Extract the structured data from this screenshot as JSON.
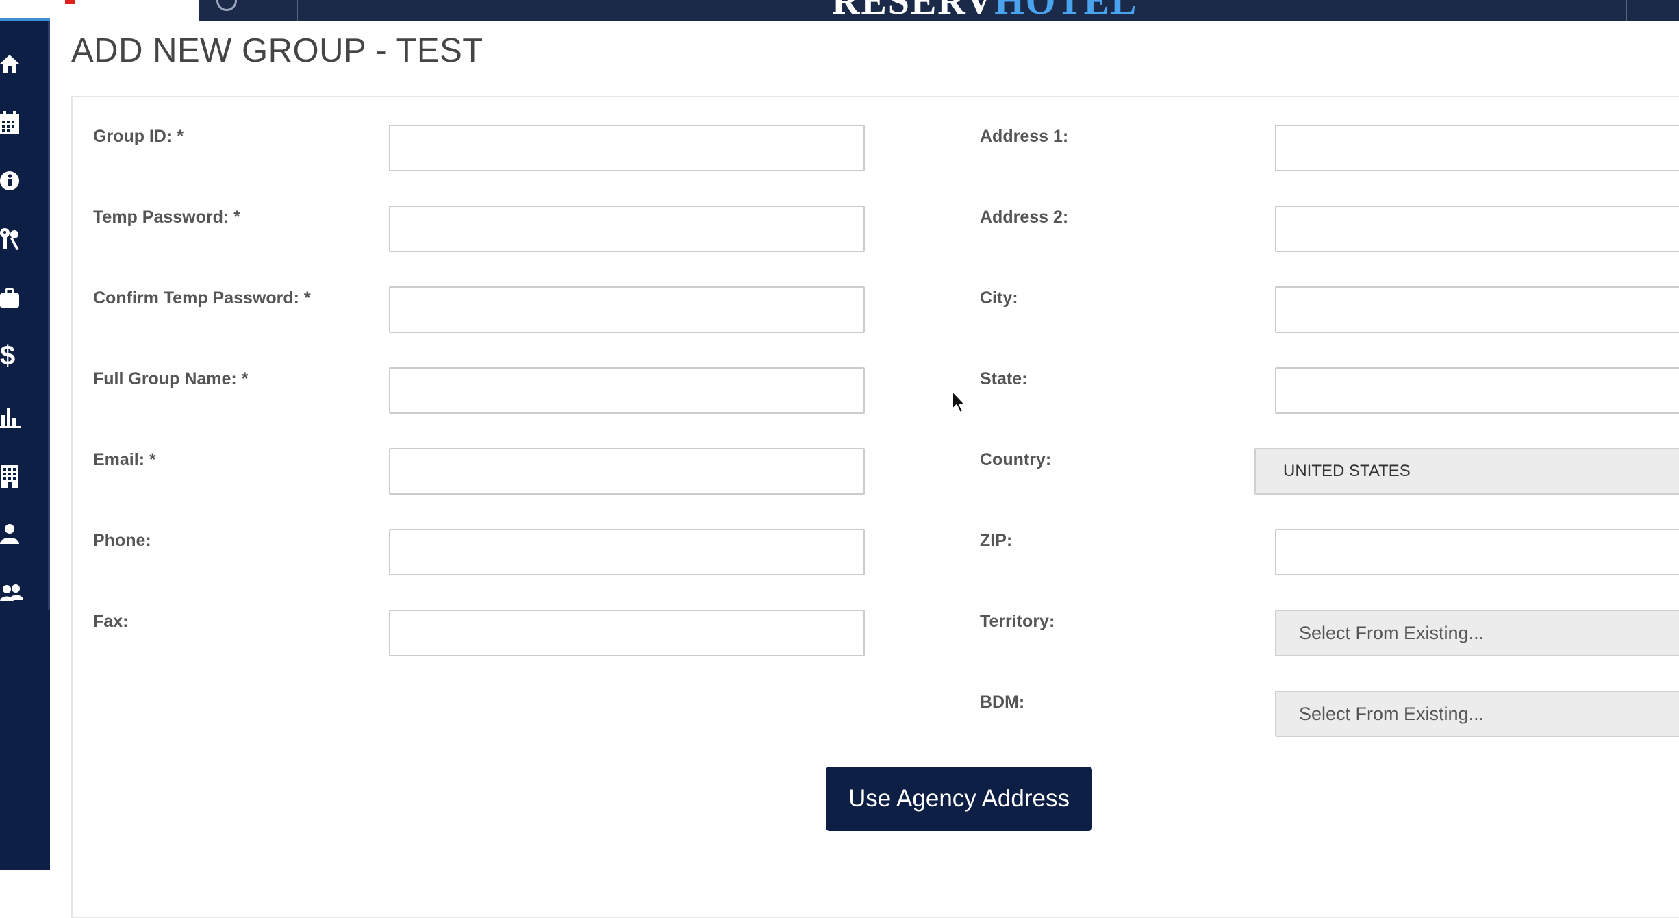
{
  "brand": {
    "part1": "RESERV",
    "part2": "HOTEL"
  },
  "page": {
    "title": "ADD NEW GROUP - TEST"
  },
  "sidebar": {
    "icons": [
      "home-icon",
      "calendar-icon",
      "info-icon",
      "keys-icon",
      "briefcase-icon",
      "dollar-icon",
      "bar-chart-icon",
      "building-icon",
      "user-icon",
      "users-icon"
    ]
  },
  "form": {
    "left": [
      {
        "label": "Group ID: *",
        "value": ""
      },
      {
        "label": "Temp Password: *",
        "value": ""
      },
      {
        "label": "Confirm Temp Password: *",
        "value": ""
      },
      {
        "label": "Full Group Name: *",
        "value": ""
      },
      {
        "label": "Email: *",
        "value": ""
      },
      {
        "label": "Phone:",
        "value": ""
      },
      {
        "label": "Fax:",
        "value": ""
      }
    ],
    "right": {
      "address1": {
        "label": "Address 1:",
        "value": ""
      },
      "address2": {
        "label": "Address 2:",
        "value": ""
      },
      "city": {
        "label": "City:",
        "value": ""
      },
      "state": {
        "label": "State:",
        "value": ""
      },
      "country": {
        "label": "Country:",
        "selected": "UNITED STATES"
      },
      "zip": {
        "label": "ZIP:",
        "value": ""
      },
      "territory": {
        "label": "Territory:",
        "selected": "Select From Existing..."
      },
      "bdm": {
        "label": "BDM:",
        "selected": "Select From Existing..."
      }
    },
    "use_agency_address_label": "Use Agency Address"
  }
}
